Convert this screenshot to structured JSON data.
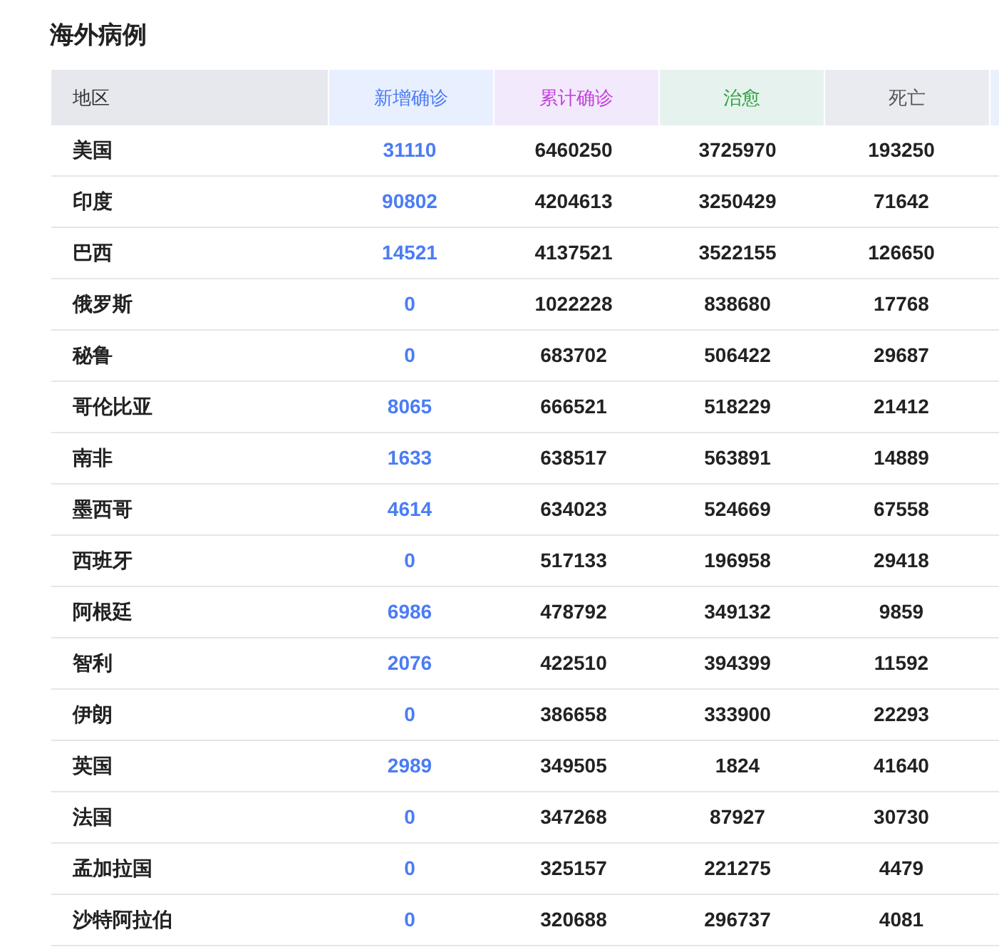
{
  "title": "海外病例",
  "table": {
    "columns": [
      {
        "label": "地区",
        "color": "#333333",
        "highlight": false
      },
      {
        "label": "新增确诊",
        "color": "#4a7cf4",
        "highlight": true
      },
      {
        "label": "累计确诊",
        "color": "#c23fdc",
        "highlight": false
      },
      {
        "label": "治愈",
        "color": "#2fa13f",
        "highlight": false
      },
      {
        "label": "死亡",
        "color": "#555555",
        "highlight": false
      }
    ],
    "rows": [
      [
        "美国",
        "31110",
        "6460250",
        "3725970",
        "193250"
      ],
      [
        "印度",
        "90802",
        "4204613",
        "3250429",
        "71642"
      ],
      [
        "巴西",
        "14521",
        "4137521",
        "3522155",
        "126650"
      ],
      [
        "俄罗斯",
        "0",
        "1022228",
        "838680",
        "17768"
      ],
      [
        "秘鲁",
        "0",
        "683702",
        "506422",
        "29687"
      ],
      [
        "哥伦比亚",
        "8065",
        "666521",
        "518229",
        "21412"
      ],
      [
        "南非",
        "1633",
        "638517",
        "563891",
        "14889"
      ],
      [
        "墨西哥",
        "4614",
        "634023",
        "524669",
        "67558"
      ],
      [
        "西班牙",
        "0",
        "517133",
        "196958",
        "29418"
      ],
      [
        "阿根廷",
        "6986",
        "478792",
        "349132",
        "9859"
      ],
      [
        "智利",
        "2076",
        "422510",
        "394399",
        "11592"
      ],
      [
        "伊朗",
        "0",
        "386658",
        "333900",
        "22293"
      ],
      [
        "英国",
        "2989",
        "349505",
        "1824",
        "41640"
      ],
      [
        "法国",
        "0",
        "347268",
        "87927",
        "30730"
      ],
      [
        "孟加拉国",
        "0",
        "325157",
        "221275",
        "4479"
      ],
      [
        "沙特阿拉伯",
        "0",
        "320688",
        "296737",
        "4081"
      ]
    ]
  }
}
